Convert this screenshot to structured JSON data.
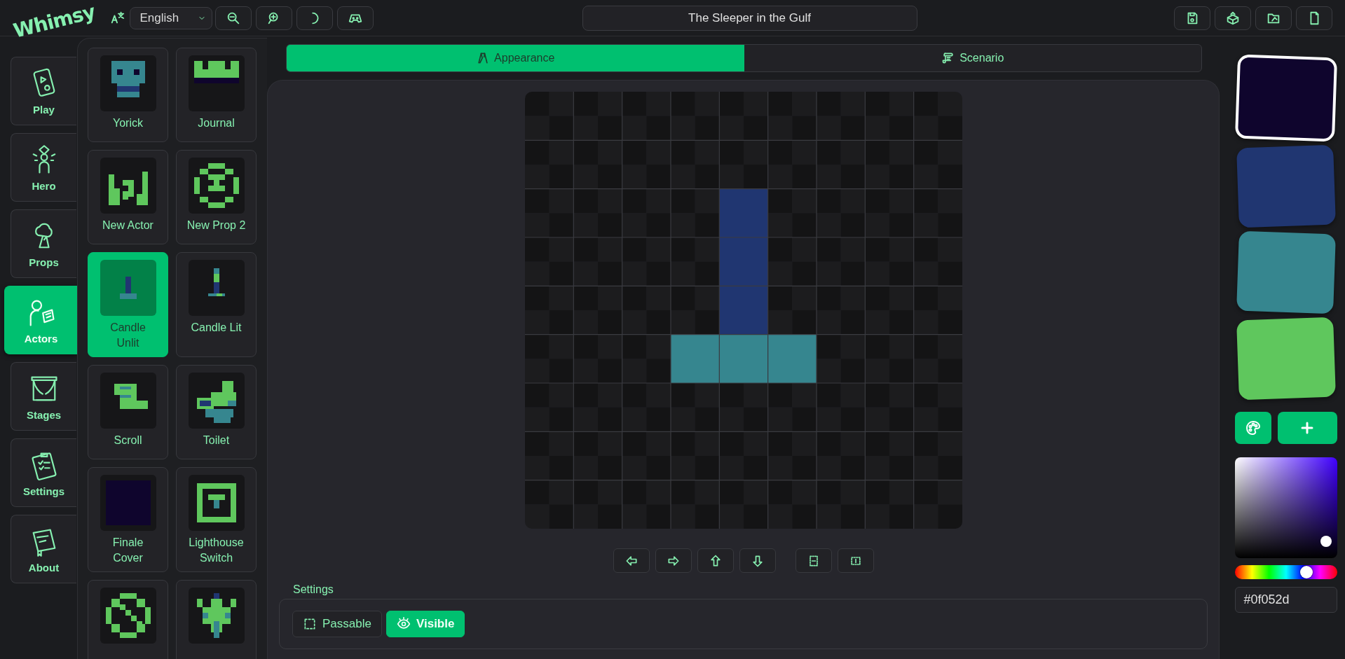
{
  "app": {
    "logo": "Whimsy",
    "language": "English",
    "title": "The Sleeper in the Gulf"
  },
  "nav": [
    {
      "label": "Play",
      "selected": false
    },
    {
      "label": "Hero",
      "selected": false
    },
    {
      "label": "Props",
      "selected": false
    },
    {
      "label": "Actors",
      "selected": true
    },
    {
      "label": "Stages",
      "selected": false
    },
    {
      "label": "Settings",
      "selected": false
    },
    {
      "label": "About",
      "selected": false
    }
  ],
  "sprites": [
    {
      "label": "Yorick",
      "selected": false
    },
    {
      "label": "Journal",
      "selected": false
    },
    {
      "label": "New Actor",
      "selected": false
    },
    {
      "label": "New Prop 2",
      "selected": false
    },
    {
      "label": "Candle Unlit",
      "selected": true
    },
    {
      "label": "Candle Lit",
      "selected": false
    },
    {
      "label": "Scroll",
      "selected": false
    },
    {
      "label": "Toilet",
      "selected": false
    },
    {
      "label": "Finale Cover",
      "selected": false
    },
    {
      "label": "Lighthouse Switch",
      "selected": false
    },
    {
      "selected": false
    },
    {
      "selected": false
    }
  ],
  "tabs": [
    {
      "label": "Appearance",
      "selected": true
    },
    {
      "label": "Scenario",
      "selected": false
    }
  ],
  "settings": {
    "legend": "Settings",
    "toggles": [
      {
        "label": "Passable",
        "on": false
      },
      {
        "label": "Visible",
        "on": true
      }
    ]
  },
  "palette": {
    "swatches": [
      {
        "color": "#0f052d",
        "selected": true
      },
      {
        "color": "#203671",
        "selected": false
      },
      {
        "color": "#36868f",
        "selected": false
      },
      {
        "color": "#5fc75d",
        "selected": false
      }
    ],
    "hue": {
      "level": 0.7
    },
    "hex": "#0f052d"
  }
}
